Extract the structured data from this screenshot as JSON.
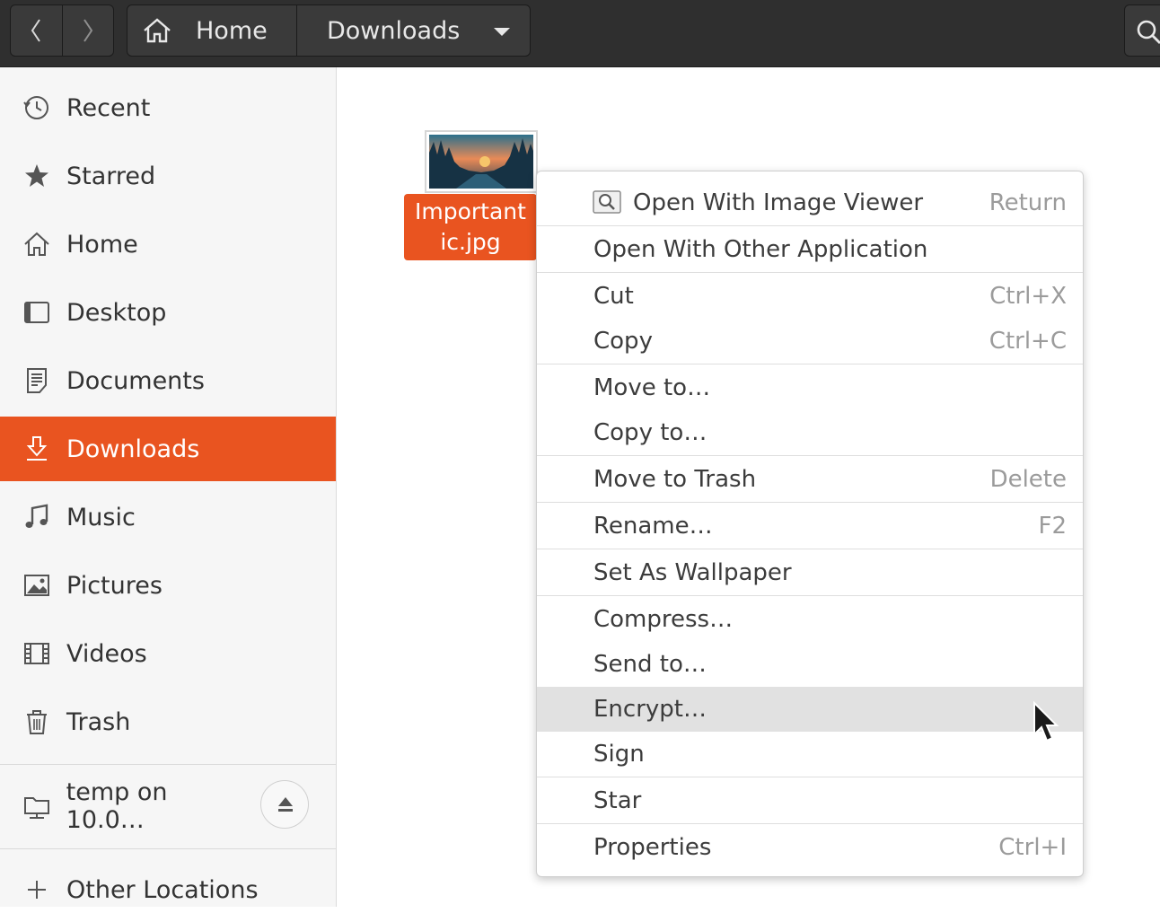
{
  "header": {
    "back_label": "back",
    "forward_label": "forward",
    "path": [
      {
        "label": "Home"
      },
      {
        "label": "Downloads"
      }
    ]
  },
  "sidebar": {
    "items": [
      {
        "label": "Recent",
        "icon": "clock-icon"
      },
      {
        "label": "Starred",
        "icon": "star-icon"
      },
      {
        "label": "Home",
        "icon": "home-icon"
      },
      {
        "label": "Desktop",
        "icon": "desktop-icon"
      },
      {
        "label": "Documents",
        "icon": "document-icon"
      },
      {
        "label": "Downloads",
        "icon": "download-icon",
        "active": true
      },
      {
        "label": "Music",
        "icon": "music-icon"
      },
      {
        "label": "Pictures",
        "icon": "picture-icon"
      },
      {
        "label": "Videos",
        "icon": "film-icon"
      },
      {
        "label": "Trash",
        "icon": "trash-icon"
      }
    ],
    "mount": {
      "label": "temp on 10.0…",
      "icon": "network-folder-icon"
    },
    "other_locations": {
      "label": "Other Locations",
      "icon": "plus-icon"
    }
  },
  "file": {
    "name_line1": "Important",
    "name_line2": "ic.jpg"
  },
  "context_menu": {
    "items": [
      {
        "label": "Open With Image Viewer",
        "accel": "Return"
      },
      {
        "label": "Open With Other Application",
        "accel": ""
      },
      {
        "label": "Cut",
        "accel": "Ctrl+X"
      },
      {
        "label": "Copy",
        "accel": "Ctrl+C"
      },
      {
        "label": "Move to…",
        "accel": ""
      },
      {
        "label": "Copy to…",
        "accel": ""
      },
      {
        "label": "Move to Trash",
        "accel": "Delete"
      },
      {
        "label": "Rename…",
        "accel": "F2"
      },
      {
        "label": "Set As Wallpaper",
        "accel": ""
      },
      {
        "label": "Compress…",
        "accel": ""
      },
      {
        "label": "Send to…",
        "accel": ""
      },
      {
        "label": "Encrypt…",
        "accel": "",
        "highlighted": true
      },
      {
        "label": "Sign",
        "accel": ""
      },
      {
        "label": "Star",
        "accel": ""
      },
      {
        "label": "Properties",
        "accel": "Ctrl+I"
      }
    ]
  },
  "colors": {
    "accent": "#e95420",
    "headerbar": "#2f2f2f",
    "sidebar_bg": "#f6f6f6",
    "menu_highlight": "#e1e1e1"
  }
}
